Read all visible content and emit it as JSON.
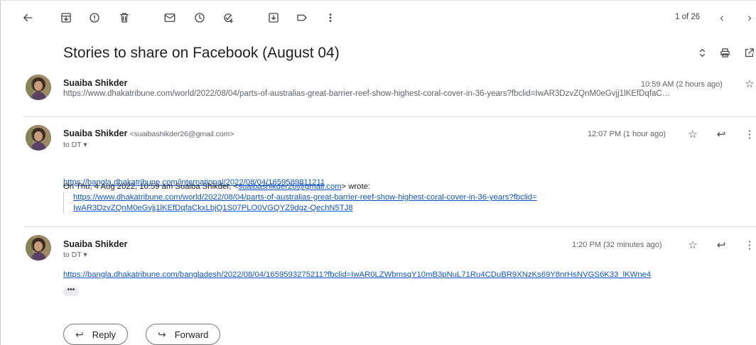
{
  "toolbar": {
    "icons": [
      "back-arrow-icon",
      "archive-icon",
      "report-spam-icon",
      "delete-icon",
      "mark-unread-icon",
      "snooze-icon",
      "add-to-tasks-icon",
      "move-to-icon",
      "label-icon",
      "more-vert-icon"
    ],
    "pager": "1 of 26",
    "prev_glyph": "‹",
    "next_glyph": "›"
  },
  "subject": "Stories to share on Facebook (August 04)",
  "messages": [
    {
      "sender": "Suaiba Shikder",
      "time": "10:59 AM (2 hours ago)",
      "snippet": "https://www.dhakatribune.com/world/2022/08/04/parts-of-australias-great-barrier-reef-show-highest-coral-cover-in-36-years?fbclid=IwAR3DzvZQnM0eGvjj1lKEfDqfaC…"
    },
    {
      "sender": "Suaiba Shikder",
      "email": "<suaibashikder26@gmail.com>",
      "to": "to DT ▾",
      "time": "12:07 PM (1 hour ago)",
      "link": "https://bangla.dhakatribune.com/international/2022/08/04/1659589811211",
      "quote_prefix": "On Thu, 4 Aug 2022, 10:59 am Suaiba Shikder, <",
      "quote_email": "suaibashikder26@gmail.com",
      "quote_suffix": "> wrote:",
      "quote_link_1": "https://www.dhakatribune.com/world/2022/08/04/parts-of-australias-great-barrier-reef-show-highest-coral-cover-in-36-years?fbclid=",
      "quote_link_2": "IwAR3DzvZQnM0eGvjj1lKEfDqfaCkxLbjQ1S07PLO0VGQYZ9dgz-QechN5TJ8"
    },
    {
      "sender": "Suaiba Shikder",
      "to": "to DT ▾",
      "time": "1:20 PM (32 minutes ago)",
      "link": "https://bangla.dhakatribune.com/bangladesh/2022/08/04/1659593275211?fbclid=IwAR0LZWbmsqY10mB3pNuL71Ru4CDuBR9XNzKs69Y8nrHsNVGS6K33_lKWne4",
      "ellipsis": "•••"
    }
  ],
  "actions": {
    "reply": "Reply",
    "forward": "Forward"
  }
}
